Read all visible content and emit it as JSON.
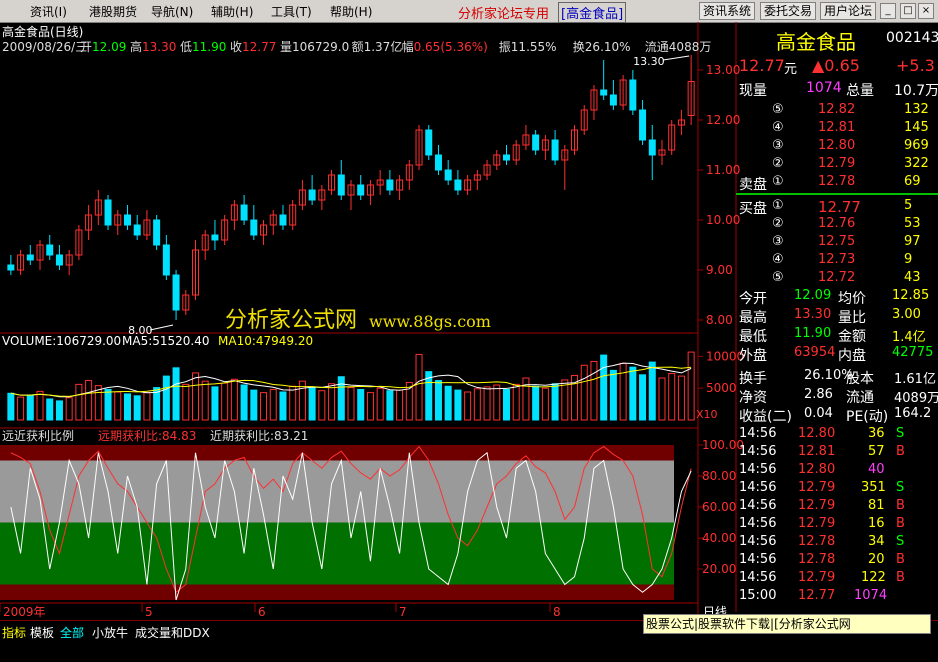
{
  "menu": {
    "items": [
      "资讯(I)",
      "港股期货",
      "导航(N)",
      "辅助(H)",
      "工具(T)",
      "帮助(H)"
    ],
    "forum_title": "分析家论坛专用",
    "forum_stock": "[高金食品]",
    "buttons": [
      "资讯系统",
      "委托交易",
      "用户论坛"
    ]
  },
  "chart_header": {
    "name": "高金食品(日线)",
    "date": "2009/08/26/三",
    "open_label": "开",
    "open": "12.09",
    "high_label": "高",
    "high": "13.30",
    "low_label": "低",
    "low": "11.90",
    "close_label": "收",
    "close": "12.77",
    "volume_label": "量",
    "volume": "106729.0",
    "amount_label": "额",
    "amount": "1.37亿",
    "range_label": "幅",
    "range": "0.65(5.36%)",
    "amplitude": "振11.55%",
    "turnover": "换26.10%",
    "float": "流通4088万"
  },
  "price_axis": [
    "13.00",
    "12.00",
    "11.00",
    "10.00",
    "9.00",
    "8.00"
  ],
  "annotations": {
    "max": "13.30",
    "min": "8.00"
  },
  "volume_header": {
    "volume": "VOLUME:106729.00",
    "ma5": "MA5:51520.40",
    "ma10": "MA10:47949.20"
  },
  "volume_axis": [
    "10000",
    "5000"
  ],
  "volume_unit": "X10",
  "indicator_header": {
    "name": "远近获利比例",
    "far": "远期获利比:84.83",
    "near": "近期获利比:83.21"
  },
  "indicator_axis": [
    "100.00",
    "80.00",
    "60.00",
    "40.00",
    "20.00"
  ],
  "date_axis": [
    "2009年",
    "5",
    "6",
    "7",
    "8"
  ],
  "period_label": "日线",
  "quote": {
    "name": "高金食品",
    "code": "002143",
    "price": "12.77",
    "unit": "元",
    "change": "▲0.65",
    "change_pct": "+5.3",
    "current_vol_label": "现量",
    "current_vol": "1074",
    "total_vol_label": "总量",
    "total_vol": "10.7万",
    "sell_label": "卖盘",
    "buy_label": "买盘",
    "sells": [
      {
        "level": "⑤",
        "price": "12.82",
        "vol": "132"
      },
      {
        "level": "④",
        "price": "12.81",
        "vol": "145"
      },
      {
        "level": "③",
        "price": "12.80",
        "vol": "969"
      },
      {
        "level": "②",
        "price": "12.79",
        "vol": "322"
      },
      {
        "level": "①",
        "price": "12.78",
        "vol": "69"
      }
    ],
    "buys": [
      {
        "level": "①",
        "price": "12.77",
        "vol": "5"
      },
      {
        "level": "②",
        "price": "12.76",
        "vol": "53"
      },
      {
        "level": "③",
        "price": "12.75",
        "vol": "97"
      },
      {
        "level": "④",
        "price": "12.73",
        "vol": "9"
      },
      {
        "level": "⑤",
        "price": "12.72",
        "vol": "43"
      }
    ],
    "stats": [
      {
        "l1": "今开",
        "v1": "12.09",
        "l2": "均价",
        "v2": "12.85"
      },
      {
        "l1": "最高",
        "v1": "13.30",
        "l2": "量比",
        "v2": "3.00"
      },
      {
        "l1": "最低",
        "v1": "11.90",
        "l2": "金额",
        "v2": "1.4亿"
      },
      {
        "l1": "外盘",
        "v1": "63954",
        "l2": "内盘",
        "v2": "42775"
      }
    ],
    "fundamentals": [
      {
        "l1": "换手",
        "v1": "26.10%",
        "l2": "股本",
        "v2": "1.61亿"
      },
      {
        "l1": "净资",
        "v1": "2.86",
        "l2": "流通",
        "v2": "4089万"
      },
      {
        "l1": "收益(二)",
        "v1": "0.04",
        "l2": "PE(动)",
        "v2": "164.2"
      }
    ],
    "ticks": [
      {
        "t": "14:56",
        "p": "12.80",
        "v": "36",
        "s": "S"
      },
      {
        "t": "14:56",
        "p": "12.81",
        "v": "57",
        "s": "B"
      },
      {
        "t": "14:56",
        "p": "12.80",
        "v": "40",
        "s": ""
      },
      {
        "t": "14:56",
        "p": "12.79",
        "v": "351",
        "s": "S"
      },
      {
        "t": "14:56",
        "p": "12.79",
        "v": "81",
        "s": "B"
      },
      {
        "t": "14:56",
        "p": "12.79",
        "v": "16",
        "s": "B"
      },
      {
        "t": "14:56",
        "p": "12.78",
        "v": "34",
        "s": "S"
      },
      {
        "t": "14:56",
        "p": "12.78",
        "v": "20",
        "s": "B"
      },
      {
        "t": "14:56",
        "p": "12.79",
        "v": "122",
        "s": "B"
      },
      {
        "t": "15:00",
        "p": "12.77",
        "v": "1074",
        "s": ""
      }
    ]
  },
  "bottom_tabs": [
    "指标",
    "模板",
    "全部",
    "小放牛",
    "成交量和DDX"
  ],
  "watermark": {
    "text": "分析家公式网",
    "url": "www.88gs.com"
  },
  "ad_text": "股票公式|股票软件下载|[分析家公式网www.88gs.com]",
  "colors": {
    "up": "#ff3030",
    "down": "#00e0ff",
    "yellow": "#ffff00",
    "axis": "#a00000",
    "band_gray": "#9a9a9a",
    "band_green": "#007000",
    "band_red": "#700000"
  },
  "chart_data": {
    "type": "candlestick",
    "ylim": [
      7.8,
      13.5
    ],
    "candles": [
      [
        9.1,
        9.3,
        8.9,
        9.0
      ],
      [
        9.0,
        9.4,
        8.9,
        9.3
      ],
      [
        9.3,
        9.5,
        9.1,
        9.2
      ],
      [
        9.2,
        9.6,
        9.0,
        9.5
      ],
      [
        9.5,
        9.7,
        9.2,
        9.3
      ],
      [
        9.3,
        9.5,
        9.0,
        9.1
      ],
      [
        9.1,
        9.4,
        8.9,
        9.3
      ],
      [
        9.3,
        9.9,
        9.2,
        9.8
      ],
      [
        9.8,
        10.3,
        9.6,
        10.1
      ],
      [
        10.1,
        10.6,
        9.9,
        10.4
      ],
      [
        10.4,
        10.5,
        9.8,
        9.9
      ],
      [
        9.9,
        10.2,
        9.7,
        10.1
      ],
      [
        10.1,
        10.3,
        9.8,
        9.9
      ],
      [
        9.9,
        10.1,
        9.6,
        9.7
      ],
      [
        9.7,
        10.2,
        9.6,
        10.0
      ],
      [
        10.0,
        10.1,
        9.4,
        9.5
      ],
      [
        9.5,
        9.7,
        8.8,
        8.9
      ],
      [
        8.9,
        9.0,
        8.0,
        8.2
      ],
      [
        8.2,
        8.6,
        8.1,
        8.5
      ],
      [
        8.5,
        9.6,
        8.4,
        9.4
      ],
      [
        9.4,
        9.8,
        9.2,
        9.7
      ],
      [
        9.7,
        10.0,
        9.4,
        9.6
      ],
      [
        9.6,
        10.1,
        9.5,
        10.0
      ],
      [
        10.0,
        10.4,
        9.8,
        10.3
      ],
      [
        10.3,
        10.5,
        9.9,
        10.0
      ],
      [
        10.0,
        10.3,
        9.6,
        9.7
      ],
      [
        9.7,
        10.0,
        9.5,
        9.9
      ],
      [
        9.9,
        10.2,
        9.7,
        10.1
      ],
      [
        10.1,
        10.3,
        9.8,
        9.9
      ],
      [
        9.9,
        10.4,
        9.8,
        10.3
      ],
      [
        10.3,
        10.8,
        10.2,
        10.6
      ],
      [
        10.6,
        10.9,
        10.3,
        10.4
      ],
      [
        10.4,
        10.7,
        10.2,
        10.6
      ],
      [
        10.6,
        11.0,
        10.5,
        10.9
      ],
      [
        10.9,
        11.2,
        10.4,
        10.5
      ],
      [
        10.5,
        10.8,
        10.2,
        10.7
      ],
      [
        10.7,
        10.9,
        10.4,
        10.5
      ],
      [
        10.5,
        10.8,
        10.3,
        10.7
      ],
      [
        10.7,
        11.0,
        10.5,
        10.8
      ],
      [
        10.8,
        11.0,
        10.5,
        10.6
      ],
      [
        10.6,
        10.9,
        10.4,
        10.8
      ],
      [
        10.8,
        11.2,
        10.6,
        11.1
      ],
      [
        11.1,
        11.9,
        11.0,
        11.8
      ],
      [
        11.8,
        11.9,
        11.2,
        11.3
      ],
      [
        11.3,
        11.5,
        10.9,
        11.0
      ],
      [
        11.0,
        11.2,
        10.7,
        10.8
      ],
      [
        10.8,
        11.0,
        10.5,
        10.6
      ],
      [
        10.6,
        10.9,
        10.5,
        10.8
      ],
      [
        10.8,
        11.0,
        10.6,
        10.9
      ],
      [
        10.9,
        11.2,
        10.8,
        11.1
      ],
      [
        11.1,
        11.4,
        11.0,
        11.3
      ],
      [
        11.3,
        11.5,
        11.1,
        11.2
      ],
      [
        11.2,
        11.6,
        11.1,
        11.5
      ],
      [
        11.5,
        11.9,
        11.4,
        11.7
      ],
      [
        11.7,
        11.8,
        11.3,
        11.4
      ],
      [
        11.4,
        11.7,
        11.2,
        11.6
      ],
      [
        11.6,
        11.8,
        11.1,
        11.2
      ],
      [
        11.2,
        11.5,
        10.6,
        11.4
      ],
      [
        11.4,
        11.9,
        11.3,
        11.8
      ],
      [
        11.8,
        12.3,
        11.7,
        12.2
      ],
      [
        12.2,
        12.7,
        12.0,
        12.6
      ],
      [
        12.6,
        13.2,
        12.4,
        12.5
      ],
      [
        12.5,
        12.8,
        12.2,
        12.3
      ],
      [
        12.3,
        12.9,
        12.2,
        12.8
      ],
      [
        12.8,
        13.0,
        12.1,
        12.2
      ],
      [
        12.2,
        12.4,
        11.5,
        11.6
      ],
      [
        11.6,
        11.9,
        10.8,
        11.3
      ],
      [
        11.3,
        11.6,
        11.1,
        11.4
      ],
      [
        11.4,
        12.0,
        11.3,
        11.9
      ],
      [
        11.9,
        12.2,
        11.7,
        12.0
      ],
      [
        12.09,
        13.3,
        11.9,
        12.77
      ]
    ],
    "volume_values": [
      4200,
      3600,
      3900,
      4500,
      3300,
      3000,
      3500,
      5600,
      6200,
      5400,
      4800,
      4400,
      4100,
      3800,
      4300,
      5100,
      6900,
      8200,
      5600,
      7400,
      6100,
      5200,
      5800,
      6400,
      5500,
      4700,
      4300,
      4800,
      4400,
      5300,
      6100,
      5200,
      4600,
      5700,
      6800,
      5100,
      4800,
      4300,
      5000,
      4600,
      4700,
      5900,
      10300,
      7600,
      6200,
      5300,
      4700,
      4400,
      4900,
      5200,
      5500,
      4800,
      5600,
      6600,
      5300,
      5000,
      5700,
      6300,
      7000,
      8600,
      9200,
      10200,
      7800,
      8900,
      8300,
      7100,
      9100,
      6600,
      7300,
      6900,
      10673
    ],
    "far_ratio": [
      95,
      92,
      88,
      70,
      45,
      30,
      55,
      80,
      90,
      96,
      85,
      75,
      70,
      60,
      50,
      40,
      20,
      5,
      10,
      40,
      70,
      75,
      85,
      90,
      92,
      80,
      72,
      78,
      70,
      88,
      95,
      90,
      85,
      92,
      96,
      88,
      82,
      78,
      85,
      80,
      84,
      92,
      99,
      90,
      75,
      55,
      40,
      35,
      45,
      60,
      75,
      80,
      88,
      93,
      86,
      82,
      70,
      52,
      60,
      85,
      95,
      99,
      94,
      90,
      80,
      55,
      20,
      15,
      30,
      60,
      84.83
    ],
    "near_ratio": [
      60,
      30,
      85,
      65,
      20,
      50,
      90,
      75,
      40,
      95,
      70,
      30,
      80,
      60,
      10,
      75,
      90,
      0,
      20,
      95,
      60,
      40,
      90,
      70,
      30,
      85,
      55,
      20,
      80,
      65,
      95,
      50,
      20,
      75,
      90,
      40,
      70,
      25,
      85,
      60,
      30,
      95,
      50,
      20,
      15,
      10,
      30,
      70,
      90,
      95,
      60,
      40,
      85,
      90,
      70,
      30,
      20,
      10,
      15,
      40,
      85,
      90,
      60,
      20,
      10,
      5,
      10,
      20,
      40,
      70,
      83.21
    ]
  }
}
